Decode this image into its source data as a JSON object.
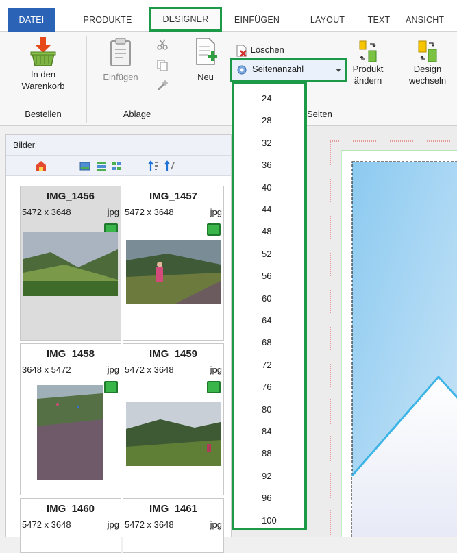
{
  "tabs": {
    "datei": "DATEI",
    "produkte": "PRODUKTE",
    "designer": "DESIGNER",
    "einfuegen": "EINFÜGEN",
    "layout": "LAYOUT",
    "text": "TEXT",
    "ansicht": "ANSICHT"
  },
  "ribbon": {
    "cart_line1": "In den",
    "cart_line2": "Warenkorb",
    "group_bestellen": "Bestellen",
    "einfuegen_label": "Einfügen",
    "group_ablage": "Ablage",
    "neu_label": "Neu",
    "loeschen_label": "Löschen",
    "seitenanzahl_label": "Seitenanzahl",
    "produkt_line1": "Produkt",
    "produkt_line2": "ändern",
    "design_line1": "Design",
    "design_line2": "wechseln",
    "group_seiten": "Seiten"
  },
  "panel": {
    "title": "Bilder",
    "images": [
      {
        "name": "IMG_1456",
        "dims": "5472 x 3648",
        "ext": "jpg"
      },
      {
        "name": "IMG_1457",
        "dims": "5472 x 3648",
        "ext": "jpg"
      },
      {
        "name": "IMG_1458",
        "dims": "3648 x 5472",
        "ext": "jpg"
      },
      {
        "name": "IMG_1459",
        "dims": "5472 x 3648",
        "ext": "jpg"
      },
      {
        "name": "IMG_1460",
        "dims": "5472 x 3648",
        "ext": "jpg"
      },
      {
        "name": "IMG_1461",
        "dims": "5472 x 3648",
        "ext": "jpg"
      }
    ]
  },
  "dropdown": {
    "options": [
      "24",
      "28",
      "32",
      "36",
      "40",
      "44",
      "48",
      "52",
      "56",
      "60",
      "64",
      "68",
      "72",
      "76",
      "80",
      "84",
      "88",
      "92",
      "96",
      "100"
    ]
  },
  "colors": {
    "highlight_green": "#1d9a48",
    "file_tab_blue": "#2b63b6"
  }
}
